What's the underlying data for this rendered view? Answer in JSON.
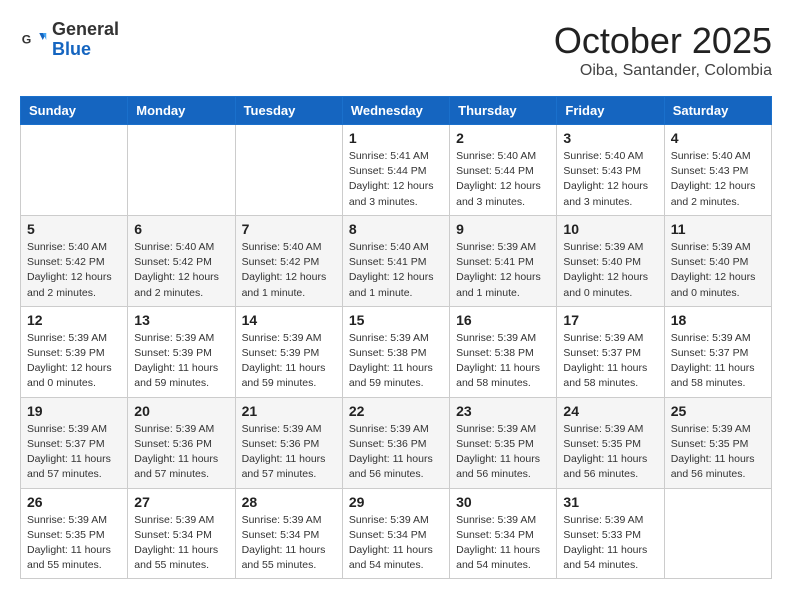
{
  "header": {
    "logo_general": "General",
    "logo_blue": "Blue",
    "month_title": "October 2025",
    "location": "Oiba, Santander, Colombia"
  },
  "weekdays": [
    "Sunday",
    "Monday",
    "Tuesday",
    "Wednesday",
    "Thursday",
    "Friday",
    "Saturday"
  ],
  "weeks": [
    [
      {
        "day": "",
        "info": ""
      },
      {
        "day": "",
        "info": ""
      },
      {
        "day": "",
        "info": ""
      },
      {
        "day": "1",
        "info": "Sunrise: 5:41 AM\nSunset: 5:44 PM\nDaylight: 12 hours\nand 3 minutes."
      },
      {
        "day": "2",
        "info": "Sunrise: 5:40 AM\nSunset: 5:44 PM\nDaylight: 12 hours\nand 3 minutes."
      },
      {
        "day": "3",
        "info": "Sunrise: 5:40 AM\nSunset: 5:43 PM\nDaylight: 12 hours\nand 3 minutes."
      },
      {
        "day": "4",
        "info": "Sunrise: 5:40 AM\nSunset: 5:43 PM\nDaylight: 12 hours\nand 2 minutes."
      }
    ],
    [
      {
        "day": "5",
        "info": "Sunrise: 5:40 AM\nSunset: 5:42 PM\nDaylight: 12 hours\nand 2 minutes."
      },
      {
        "day": "6",
        "info": "Sunrise: 5:40 AM\nSunset: 5:42 PM\nDaylight: 12 hours\nand 2 minutes."
      },
      {
        "day": "7",
        "info": "Sunrise: 5:40 AM\nSunset: 5:42 PM\nDaylight: 12 hours\nand 1 minute."
      },
      {
        "day": "8",
        "info": "Sunrise: 5:40 AM\nSunset: 5:41 PM\nDaylight: 12 hours\nand 1 minute."
      },
      {
        "day": "9",
        "info": "Sunrise: 5:39 AM\nSunset: 5:41 PM\nDaylight: 12 hours\nand 1 minute."
      },
      {
        "day": "10",
        "info": "Sunrise: 5:39 AM\nSunset: 5:40 PM\nDaylight: 12 hours\nand 0 minutes."
      },
      {
        "day": "11",
        "info": "Sunrise: 5:39 AM\nSunset: 5:40 PM\nDaylight: 12 hours\nand 0 minutes."
      }
    ],
    [
      {
        "day": "12",
        "info": "Sunrise: 5:39 AM\nSunset: 5:39 PM\nDaylight: 12 hours\nand 0 minutes."
      },
      {
        "day": "13",
        "info": "Sunrise: 5:39 AM\nSunset: 5:39 PM\nDaylight: 11 hours\nand 59 minutes."
      },
      {
        "day": "14",
        "info": "Sunrise: 5:39 AM\nSunset: 5:39 PM\nDaylight: 11 hours\nand 59 minutes."
      },
      {
        "day": "15",
        "info": "Sunrise: 5:39 AM\nSunset: 5:38 PM\nDaylight: 11 hours\nand 59 minutes."
      },
      {
        "day": "16",
        "info": "Sunrise: 5:39 AM\nSunset: 5:38 PM\nDaylight: 11 hours\nand 58 minutes."
      },
      {
        "day": "17",
        "info": "Sunrise: 5:39 AM\nSunset: 5:37 PM\nDaylight: 11 hours\nand 58 minutes."
      },
      {
        "day": "18",
        "info": "Sunrise: 5:39 AM\nSunset: 5:37 PM\nDaylight: 11 hours\nand 58 minutes."
      }
    ],
    [
      {
        "day": "19",
        "info": "Sunrise: 5:39 AM\nSunset: 5:37 PM\nDaylight: 11 hours\nand 57 minutes."
      },
      {
        "day": "20",
        "info": "Sunrise: 5:39 AM\nSunset: 5:36 PM\nDaylight: 11 hours\nand 57 minutes."
      },
      {
        "day": "21",
        "info": "Sunrise: 5:39 AM\nSunset: 5:36 PM\nDaylight: 11 hours\nand 57 minutes."
      },
      {
        "day": "22",
        "info": "Sunrise: 5:39 AM\nSunset: 5:36 PM\nDaylight: 11 hours\nand 56 minutes."
      },
      {
        "day": "23",
        "info": "Sunrise: 5:39 AM\nSunset: 5:35 PM\nDaylight: 11 hours\nand 56 minutes."
      },
      {
        "day": "24",
        "info": "Sunrise: 5:39 AM\nSunset: 5:35 PM\nDaylight: 11 hours\nand 56 minutes."
      },
      {
        "day": "25",
        "info": "Sunrise: 5:39 AM\nSunset: 5:35 PM\nDaylight: 11 hours\nand 56 minutes."
      }
    ],
    [
      {
        "day": "26",
        "info": "Sunrise: 5:39 AM\nSunset: 5:35 PM\nDaylight: 11 hours\nand 55 minutes."
      },
      {
        "day": "27",
        "info": "Sunrise: 5:39 AM\nSunset: 5:34 PM\nDaylight: 11 hours\nand 55 minutes."
      },
      {
        "day": "28",
        "info": "Sunrise: 5:39 AM\nSunset: 5:34 PM\nDaylight: 11 hours\nand 55 minutes."
      },
      {
        "day": "29",
        "info": "Sunrise: 5:39 AM\nSunset: 5:34 PM\nDaylight: 11 hours\nand 54 minutes."
      },
      {
        "day": "30",
        "info": "Sunrise: 5:39 AM\nSunset: 5:34 PM\nDaylight: 11 hours\nand 54 minutes."
      },
      {
        "day": "31",
        "info": "Sunrise: 5:39 AM\nSunset: 5:33 PM\nDaylight: 11 hours\nand 54 minutes."
      },
      {
        "day": "",
        "info": ""
      }
    ]
  ]
}
